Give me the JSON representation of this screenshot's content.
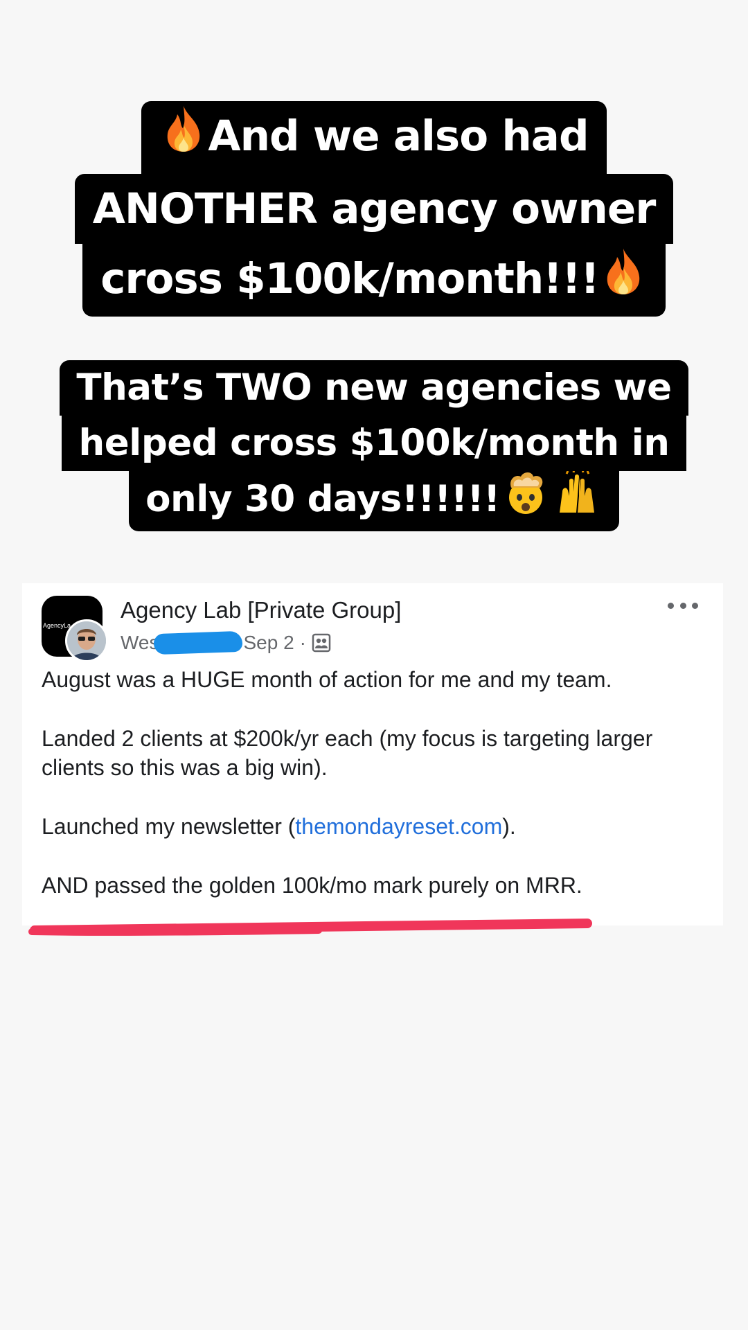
{
  "caption_top": {
    "line1": "And we also had",
    "line2": "ANOTHER agency owner",
    "line3": "cross $100k/month!!!",
    "emoji_left": "fire-emoji",
    "emoji_right": "fire-emoji"
  },
  "caption_bottom": {
    "line1": "That’s TWO new agencies we",
    "line2": "helped cross $100k/month in",
    "line3": "only 30 days!!!!!!",
    "emoji_1": "exploding-head-emoji",
    "emoji_2": "raised-hands-emoji"
  },
  "post": {
    "group_name": "Agency Lab [Private Group]",
    "group_avatar_text": "AgencyLa",
    "author_visible": "Wes",
    "date": "Sep 2",
    "separator": "·",
    "privacy_icon": "group-privacy-icon",
    "more_icon": "more-options-icon",
    "paragraph1": "August was a HUGE month of action for me and my team.",
    "paragraph2": "Landed 2 clients at $200k/yr each (my focus is targeting larger clients so this was a big win).",
    "paragraph3_before": "Launched my newsletter (",
    "paragraph3_link": "themondayreset.com",
    "paragraph3_after": ").",
    "paragraph4": "AND passed the golden 100k/mo mark purely on MRR."
  },
  "colors": {
    "caption_bg": "#000000",
    "caption_text": "#ffffff",
    "link": "#216fdb",
    "redaction": "#1a8fe8",
    "underline": "#f0365a"
  }
}
